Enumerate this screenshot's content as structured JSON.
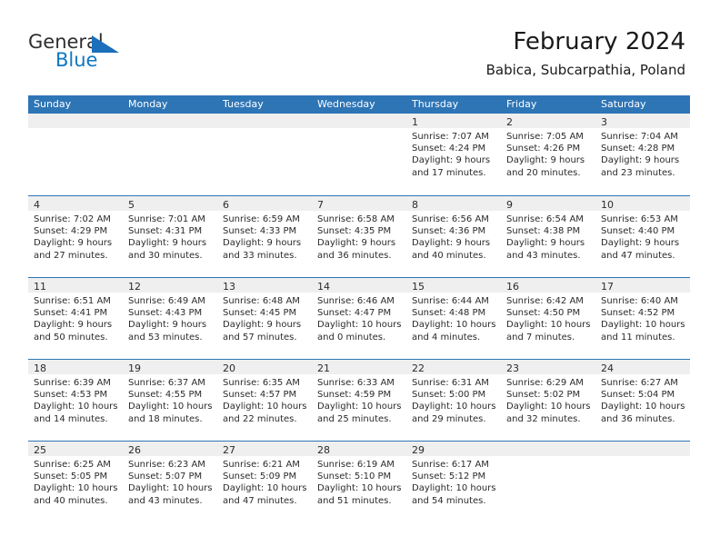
{
  "brand": {
    "word_one": "General",
    "word_two": "Blue",
    "mark": "triangle-flag-icon",
    "color_primary": "#1077c3",
    "color_text": "#2e2e2e"
  },
  "header": {
    "month_title": "February 2024",
    "location": "Babica, Subcarpathia, Poland"
  },
  "theme": {
    "header_blue": "#2e75b6",
    "daynum_band": "#efefef",
    "text": "#2b2b2b"
  },
  "calendar": {
    "weekdays": [
      "Sunday",
      "Monday",
      "Tuesday",
      "Wednesday",
      "Thursday",
      "Friday",
      "Saturday"
    ],
    "weeks": [
      [
        {
          "day": "",
          "lines": []
        },
        {
          "day": "",
          "lines": []
        },
        {
          "day": "",
          "lines": []
        },
        {
          "day": "",
          "lines": []
        },
        {
          "day": "1",
          "lines": [
            "Sunrise: 7:07 AM",
            "Sunset: 4:24 PM",
            "Daylight: 9 hours",
            "and 17 minutes."
          ]
        },
        {
          "day": "2",
          "lines": [
            "Sunrise: 7:05 AM",
            "Sunset: 4:26 PM",
            "Daylight: 9 hours",
            "and 20 minutes."
          ]
        },
        {
          "day": "3",
          "lines": [
            "Sunrise: 7:04 AM",
            "Sunset: 4:28 PM",
            "Daylight: 9 hours",
            "and 23 minutes."
          ]
        }
      ],
      [
        {
          "day": "4",
          "lines": [
            "Sunrise: 7:02 AM",
            "Sunset: 4:29 PM",
            "Daylight: 9 hours",
            "and 27 minutes."
          ]
        },
        {
          "day": "5",
          "lines": [
            "Sunrise: 7:01 AM",
            "Sunset: 4:31 PM",
            "Daylight: 9 hours",
            "and 30 minutes."
          ]
        },
        {
          "day": "6",
          "lines": [
            "Sunrise: 6:59 AM",
            "Sunset: 4:33 PM",
            "Daylight: 9 hours",
            "and 33 minutes."
          ]
        },
        {
          "day": "7",
          "lines": [
            "Sunrise: 6:58 AM",
            "Sunset: 4:35 PM",
            "Daylight: 9 hours",
            "and 36 minutes."
          ]
        },
        {
          "day": "8",
          "lines": [
            "Sunrise: 6:56 AM",
            "Sunset: 4:36 PM",
            "Daylight: 9 hours",
            "and 40 minutes."
          ]
        },
        {
          "day": "9",
          "lines": [
            "Sunrise: 6:54 AM",
            "Sunset: 4:38 PM",
            "Daylight: 9 hours",
            "and 43 minutes."
          ]
        },
        {
          "day": "10",
          "lines": [
            "Sunrise: 6:53 AM",
            "Sunset: 4:40 PM",
            "Daylight: 9 hours",
            "and 47 minutes."
          ]
        }
      ],
      [
        {
          "day": "11",
          "lines": [
            "Sunrise: 6:51 AM",
            "Sunset: 4:41 PM",
            "Daylight: 9 hours",
            "and 50 minutes."
          ]
        },
        {
          "day": "12",
          "lines": [
            "Sunrise: 6:49 AM",
            "Sunset: 4:43 PM",
            "Daylight: 9 hours",
            "and 53 minutes."
          ]
        },
        {
          "day": "13",
          "lines": [
            "Sunrise: 6:48 AM",
            "Sunset: 4:45 PM",
            "Daylight: 9 hours",
            "and 57 minutes."
          ]
        },
        {
          "day": "14",
          "lines": [
            "Sunrise: 6:46 AM",
            "Sunset: 4:47 PM",
            "Daylight: 10 hours",
            "and 0 minutes."
          ]
        },
        {
          "day": "15",
          "lines": [
            "Sunrise: 6:44 AM",
            "Sunset: 4:48 PM",
            "Daylight: 10 hours",
            "and 4 minutes."
          ]
        },
        {
          "day": "16",
          "lines": [
            "Sunrise: 6:42 AM",
            "Sunset: 4:50 PM",
            "Daylight: 10 hours",
            "and 7 minutes."
          ]
        },
        {
          "day": "17",
          "lines": [
            "Sunrise: 6:40 AM",
            "Sunset: 4:52 PM",
            "Daylight: 10 hours",
            "and 11 minutes."
          ]
        }
      ],
      [
        {
          "day": "18",
          "lines": [
            "Sunrise: 6:39 AM",
            "Sunset: 4:53 PM",
            "Daylight: 10 hours",
            "and 14 minutes."
          ]
        },
        {
          "day": "19",
          "lines": [
            "Sunrise: 6:37 AM",
            "Sunset: 4:55 PM",
            "Daylight: 10 hours",
            "and 18 minutes."
          ]
        },
        {
          "day": "20",
          "lines": [
            "Sunrise: 6:35 AM",
            "Sunset: 4:57 PM",
            "Daylight: 10 hours",
            "and 22 minutes."
          ]
        },
        {
          "day": "21",
          "lines": [
            "Sunrise: 6:33 AM",
            "Sunset: 4:59 PM",
            "Daylight: 10 hours",
            "and 25 minutes."
          ]
        },
        {
          "day": "22",
          "lines": [
            "Sunrise: 6:31 AM",
            "Sunset: 5:00 PM",
            "Daylight: 10 hours",
            "and 29 minutes."
          ]
        },
        {
          "day": "23",
          "lines": [
            "Sunrise: 6:29 AM",
            "Sunset: 5:02 PM",
            "Daylight: 10 hours",
            "and 32 minutes."
          ]
        },
        {
          "day": "24",
          "lines": [
            "Sunrise: 6:27 AM",
            "Sunset: 5:04 PM",
            "Daylight: 10 hours",
            "and 36 minutes."
          ]
        }
      ],
      [
        {
          "day": "25",
          "lines": [
            "Sunrise: 6:25 AM",
            "Sunset: 5:05 PM",
            "Daylight: 10 hours",
            "and 40 minutes."
          ]
        },
        {
          "day": "26",
          "lines": [
            "Sunrise: 6:23 AM",
            "Sunset: 5:07 PM",
            "Daylight: 10 hours",
            "and 43 minutes."
          ]
        },
        {
          "day": "27",
          "lines": [
            "Sunrise: 6:21 AM",
            "Sunset: 5:09 PM",
            "Daylight: 10 hours",
            "and 47 minutes."
          ]
        },
        {
          "day": "28",
          "lines": [
            "Sunrise: 6:19 AM",
            "Sunset: 5:10 PM",
            "Daylight: 10 hours",
            "and 51 minutes."
          ]
        },
        {
          "day": "29",
          "lines": [
            "Sunrise: 6:17 AM",
            "Sunset: 5:12 PM",
            "Daylight: 10 hours",
            "and 54 minutes."
          ]
        },
        {
          "day": "",
          "lines": []
        },
        {
          "day": "",
          "lines": []
        }
      ]
    ]
  }
}
